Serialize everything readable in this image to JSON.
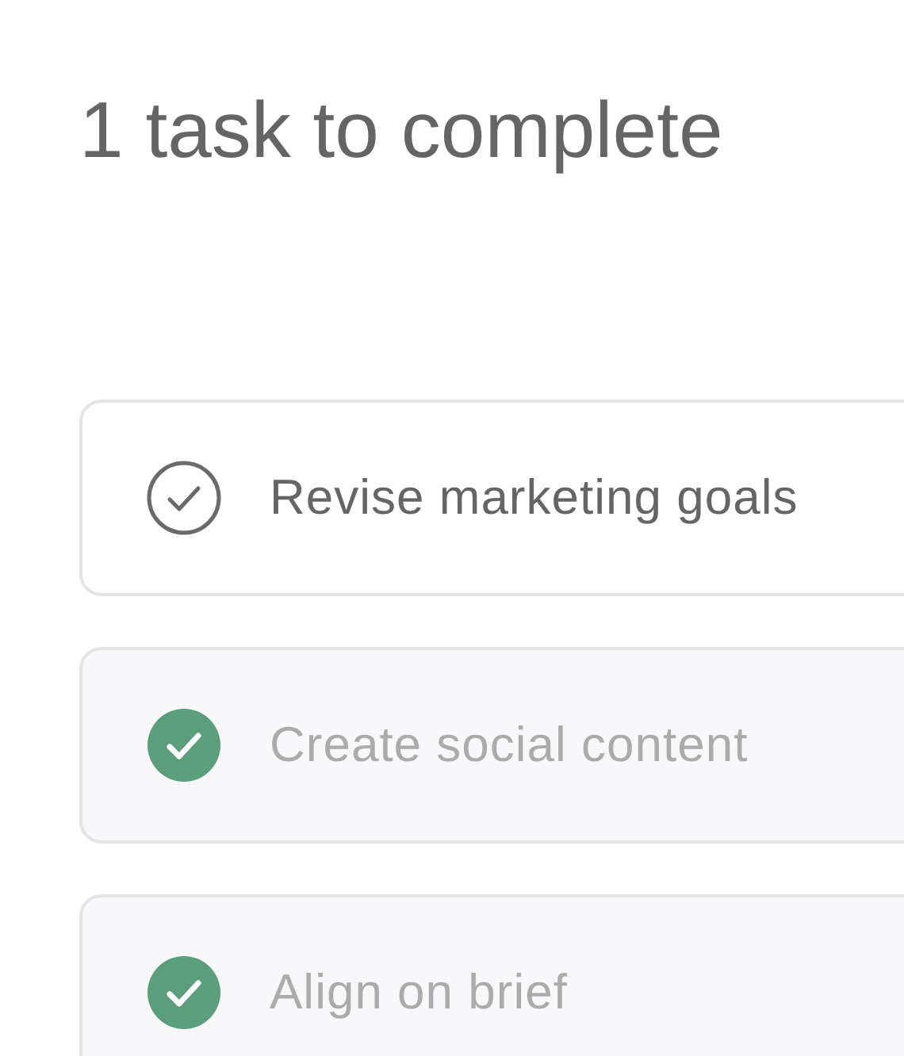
{
  "heading": "1 task to complete",
  "tasks": [
    {
      "label": "Revise marketing goals",
      "completed": false
    },
    {
      "label": "Create social content",
      "completed": true
    },
    {
      "label": "Align on brief",
      "completed": true
    }
  ]
}
